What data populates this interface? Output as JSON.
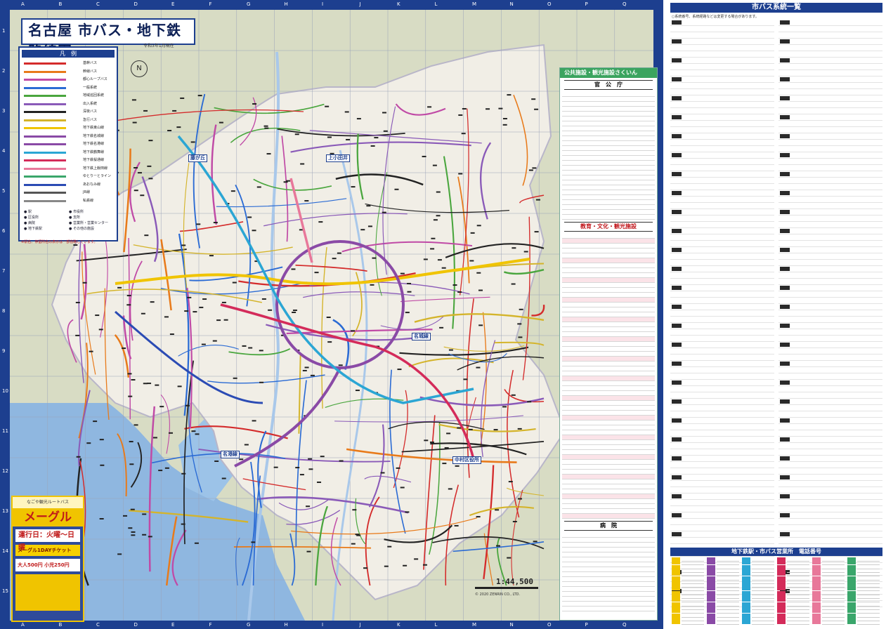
{
  "map": {
    "title": "名古屋 市バス・地下鉄路線図",
    "date": "令和3年1月現在",
    "scale": "1:44,500",
    "col_letters": [
      "A",
      "B",
      "C",
      "D",
      "E",
      "F",
      "G",
      "H",
      "I",
      "J",
      "K",
      "L",
      "M",
      "N",
      "O",
      "P",
      "Q"
    ],
    "row_numbers": [
      "1",
      "2",
      "3",
      "4",
      "5",
      "6",
      "7",
      "8",
      "9",
      "10",
      "11",
      "12",
      "13",
      "14",
      "15"
    ],
    "copyright": "© 2020 ZENRIN CO., LTD.",
    "place_labels": [
      "藤が丘",
      "名城線",
      "名港線",
      "上小田井",
      "中村区役所"
    ],
    "compass_symbol": "N"
  },
  "legend": {
    "title": "凡　例",
    "items": [
      {
        "label": "基幹バス",
        "color": "#d42b2b"
      },
      {
        "label": "幹線バス",
        "color": "#e87a1a"
      },
      {
        "label": "都心ループバス",
        "color": "#c04aa6"
      },
      {
        "label": "一般系統",
        "color": "#2b6bd4"
      },
      {
        "label": "地域巡回系統",
        "color": "#4aa63e"
      },
      {
        "label": "出入系統",
        "color": "#8a5ab8"
      },
      {
        "label": "深夜バス",
        "color": "#222222"
      },
      {
        "label": "急行バス",
        "color": "#d4b42b"
      },
      {
        "label": "地下鉄東山線",
        "color": "#f0c400"
      },
      {
        "label": "地下鉄名城線",
        "color": "#8a4aa6"
      },
      {
        "label": "地下鉄名港線",
        "color": "#8a4aa6"
      },
      {
        "label": "地下鉄鶴舞線",
        "color": "#2ba6d4"
      },
      {
        "label": "地下鉄桜通線",
        "color": "#d42b5a"
      },
      {
        "label": "地下鉄上飯田線",
        "color": "#e8789a"
      },
      {
        "label": "ゆとりーとライン",
        "color": "#3aa66b"
      },
      {
        "label": "あおなみ線",
        "color": "#2b4bb4"
      },
      {
        "label": "JR線",
        "color": "#555555"
      },
      {
        "label": "私鉄線",
        "color": "#888888"
      }
    ],
    "symbols": [
      "駅",
      "市役所",
      "区役所",
      "支所",
      "病院",
      "営業所・営業センター",
      "地下鉄駅",
      "その他の施設"
    ],
    "note": "※駅名、停留所名の表示は一部省略しています。"
  },
  "meguru": {
    "top": "なごや観光ルートバス",
    "name": "メーグル",
    "days": "運行日：火曜～日曜",
    "ticket": "メーグル1DAYチケット",
    "price_adult": "大人500円",
    "price_child": "小児250円"
  },
  "index": {
    "title": "公共施設・観光施設さくいん",
    "sections": [
      "官　公　庁",
      "教育・文化・観光施設",
      "病　院"
    ]
  },
  "right": {
    "header": "市バス系統一覧",
    "note": "○系統番号、系統経路などは変更する場合があります。",
    "tel_header": "地下鉄駅・市バス営業所　電話番号"
  }
}
